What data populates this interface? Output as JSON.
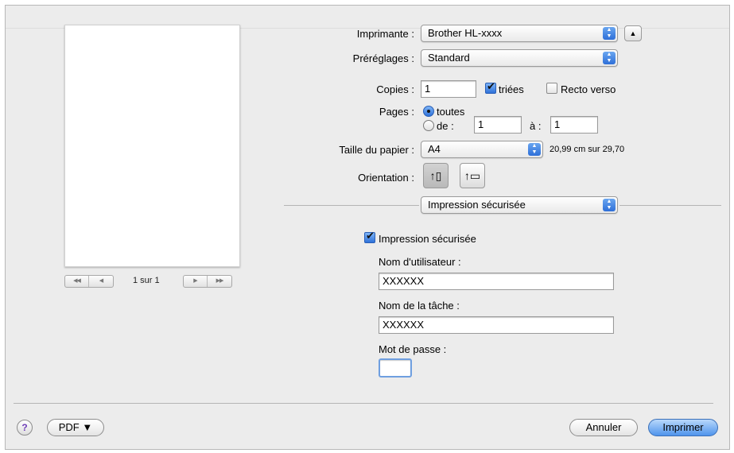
{
  "preview": {
    "nav_first": "◀◀",
    "nav_prev": "◀",
    "page_count": "1 sur 1",
    "nav_next": "▶",
    "nav_last": "▶▶"
  },
  "printer": {
    "label": "Imprimante :",
    "value": "Brother HL-xxxx"
  },
  "presets": {
    "label": "Préréglages :",
    "value": "Standard"
  },
  "copies": {
    "label": "Copies :",
    "value": "1",
    "collated_label": "triées",
    "collated": true,
    "duplex_label": "Recto verso",
    "duplex": false
  },
  "pages": {
    "label": "Pages :",
    "all_label": "toutes",
    "range_label": "de :",
    "from": "1",
    "to_label": "à :",
    "to": "1",
    "selected": "all"
  },
  "paper_size": {
    "label": "Taille du papier :",
    "value": "A4",
    "dimensions": "20,99 cm sur 29,70"
  },
  "orientation": {
    "label": "Orientation :",
    "portrait_icon": "portrait-icon",
    "landscape_icon": "landscape-icon",
    "selected": "portrait"
  },
  "panel_select": {
    "value": "Impression sécurisée"
  },
  "secure": {
    "checkbox_label": "Impression sécurisée",
    "enabled": true,
    "user_label": "Nom d'utilisateur :",
    "user_value": "XXXXXX",
    "job_label": "Nom de la tâche :",
    "job_value": "XXXXXX",
    "password_label": "Mot de passe :",
    "password_value": ""
  },
  "footer": {
    "help": "?",
    "pdf": "PDF ▼",
    "cancel": "Annuler",
    "print": "Imprimer"
  },
  "colors": {
    "accent": "#2f72d9",
    "default_button": "#4f94ec",
    "dialog_bg": "#ececec"
  }
}
